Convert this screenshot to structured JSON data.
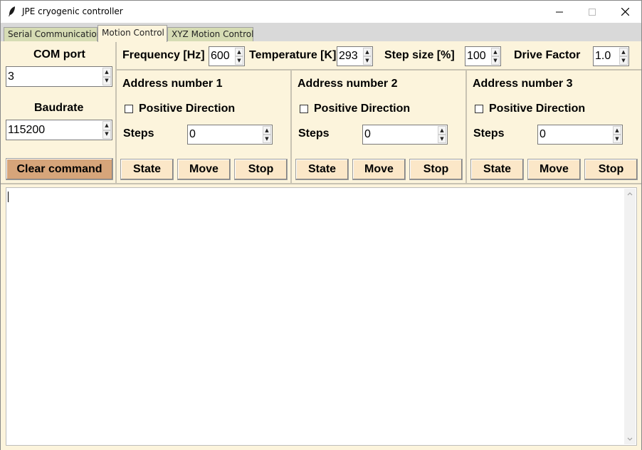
{
  "window": {
    "title": "JPE cryogenic controller",
    "minimize_glyph": "—",
    "maximize_glyph": "☐",
    "close_glyph": "✕"
  },
  "tabs": [
    {
      "label": "Serial Communication"
    },
    {
      "label": "Motion Control",
      "active": true
    },
    {
      "label": "XYZ Motion Control"
    }
  ],
  "serial": {
    "com_port_label": "COM port",
    "com_port_value": "3",
    "baudrate_label": "Baudrate",
    "baudrate_value": "115200",
    "clear_label": "Clear command"
  },
  "params": {
    "frequency_label": "Frequency [Hz]",
    "frequency_value": "600",
    "temperature_label": "Temperature [K]",
    "temperature_value": "293",
    "stepsize_label": "Step size [%]",
    "stepsize_value": "100",
    "drivefactor_label": "Drive Factor",
    "drivefactor_value": "1.0"
  },
  "addresses": [
    {
      "title": "Address number 1",
      "direction_label": "Positive Direction",
      "steps_label": "Steps",
      "steps_value": "0",
      "state_label": "State",
      "move_label": "Move",
      "stop_label": "Stop"
    },
    {
      "title": "Address number 2",
      "direction_label": "Positive Direction",
      "steps_label": "Steps",
      "steps_value": "0",
      "state_label": "State",
      "move_label": "Move",
      "stop_label": "Stop"
    },
    {
      "title": "Address number 3",
      "direction_label": "Positive Direction",
      "steps_label": "Steps",
      "steps_value": "0",
      "state_label": "State",
      "move_label": "Move",
      "stop_label": "Stop"
    }
  ],
  "colors": {
    "panel_bg": "#fcf4dc",
    "button_bg": "#fbe7c8",
    "clear_button_bg": "#d6a57a",
    "tab_bg": "#d6dcb4"
  }
}
